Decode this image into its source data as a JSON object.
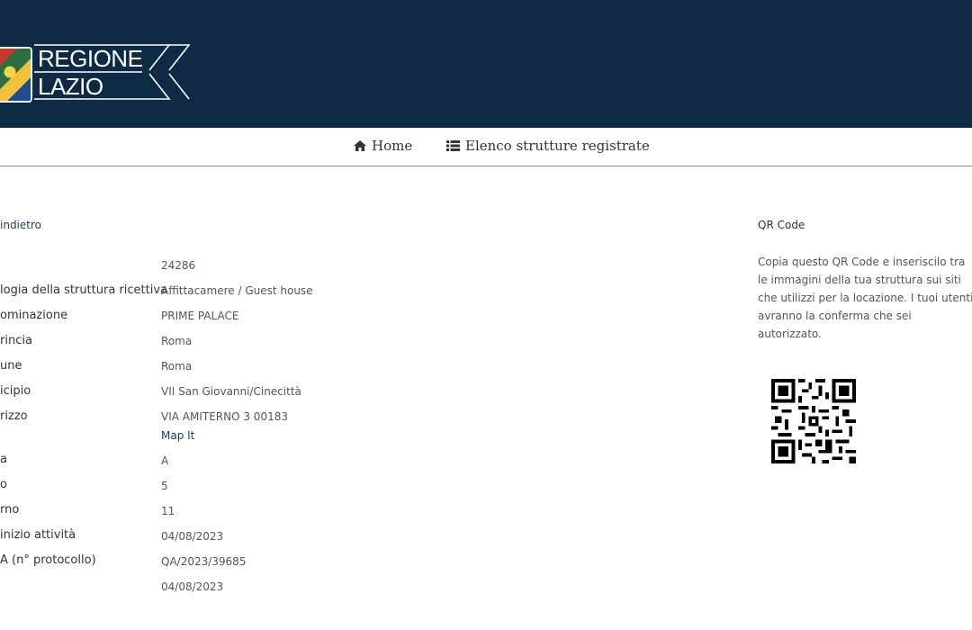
{
  "header": {
    "logo_line1": "REGIONE",
    "logo_line2": "LAZIO",
    "brand_color": "#0f2a44"
  },
  "nav": {
    "items": [
      {
        "label": "Home",
        "icon": "home-icon"
      },
      {
        "label": "Elenco strutture registrate",
        "icon": "list-icon"
      }
    ]
  },
  "back_label": "indietro",
  "details": [
    {
      "label": "",
      "value": "24286"
    },
    {
      "label": "logia della struttura ricettiva",
      "value": "Affittacamere / Guest house"
    },
    {
      "label": "ominazione",
      "value": "PRIME PALACE"
    },
    {
      "label": "rincia",
      "value": "Roma"
    },
    {
      "label": "une",
      "value": "Roma"
    },
    {
      "label": "icipio",
      "value": "VII San Giovanni/Cinecittà"
    },
    {
      "label": "rizzo",
      "value": "VIA AMITERNO 3 00183"
    },
    {
      "label": "a",
      "value": "A"
    },
    {
      "label": "o",
      "value": "5"
    },
    {
      "label": "rno",
      "value": "11"
    },
    {
      "label": " inizio attività",
      "value": "04/08/2023"
    },
    {
      "label": "A (n° protocollo)",
      "value": "QA/2023/39685"
    },
    {
      "label": "",
      "value": "04/08/2023"
    }
  ],
  "map_link": "Map It",
  "qr": {
    "title": "QR Code",
    "description": "Copia questo QR Code e inseriscilo tra le immagini della tua struttura sui siti che utilizzi per la locazione. I tuoi utenti avranno la conferma che sei autorizzato."
  }
}
